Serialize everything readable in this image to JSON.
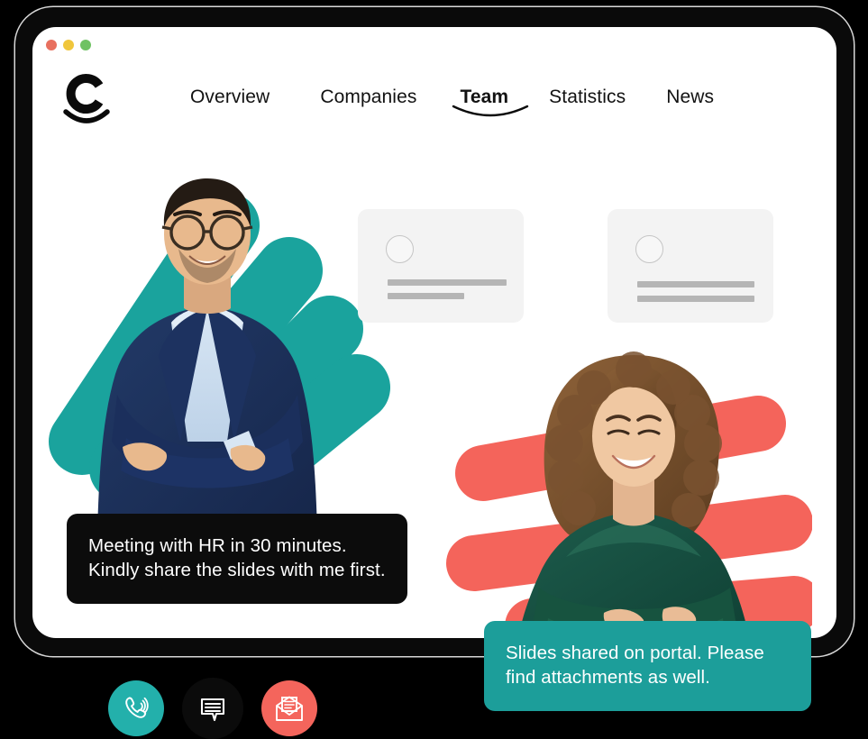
{
  "window": {
    "traffic_lights": [
      {
        "name": "close",
        "color": "#e8705f"
      },
      {
        "name": "minimize",
        "color": "#f0c63c"
      },
      {
        "name": "maximize",
        "color": "#6fc263"
      }
    ]
  },
  "brand": {
    "logo_icon": "letter-c-smile-logo",
    "logo_letter": "C"
  },
  "nav": {
    "items": [
      {
        "label": "Overview",
        "active": false
      },
      {
        "label": "Companies",
        "active": false
      },
      {
        "label": "Team",
        "active": true
      },
      {
        "label": "Statistics",
        "active": false
      },
      {
        "label": "News",
        "active": false
      }
    ]
  },
  "skeleton_cards": [
    {
      "avatar_icon": "avatar-placeholder-circle",
      "bars": [
        "bar-long",
        "bar-short"
      ]
    },
    {
      "avatar_icon": "avatar-placeholder-circle",
      "bars": [
        "bar-long",
        "bar-long"
      ]
    }
  ],
  "people": [
    {
      "name": "man-in-navy-suit-photo",
      "description": "Smiling man with glasses in navy suit, arms crossed"
    },
    {
      "name": "woman-in-green-blouse-photo",
      "description": "Smiling woman with curly hair in green blouse, arms crossed"
    }
  ],
  "decor": {
    "teal_blobs": "teal-petal-shapes",
    "coral_blobs": "coral-bar-shapes",
    "teal_color": "#1aa39d",
    "coral_color": "#f4645b"
  },
  "messages": [
    {
      "id": "incoming",
      "text": "Meeting with HR in 30 minutes. Kindly share the slides with me first.",
      "bg_color": "#0c0c0c",
      "text_color": "#ffffff"
    },
    {
      "id": "outgoing",
      "text": "Slides shared on portal. Please find attachments as well.",
      "bg_color": "#1c9e9a",
      "text_color": "#ffffff"
    }
  ],
  "action_bar": {
    "items": [
      {
        "icon": "phone-call-icon",
        "label": "Call",
        "bg_color": "#23b0ab"
      },
      {
        "icon": "chat-bubble-icon",
        "label": "Chat",
        "bg_color": "#0b0b0b"
      },
      {
        "icon": "open-envelope-icon",
        "label": "Mail",
        "bg_color": "#f4655c"
      }
    ]
  }
}
